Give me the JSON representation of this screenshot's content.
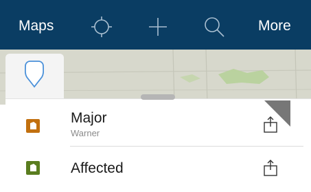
{
  "topbar": {
    "maps_label": "Maps",
    "more_label": "More",
    "icons": [
      "locate-icon",
      "plus-icon",
      "search-icon"
    ],
    "background": "#0a3d63"
  },
  "pin_tab": {
    "icon": "map-pin-icon",
    "accent": "#4a90d9"
  },
  "features": [
    {
      "title": "Major",
      "subtitle": "Warner",
      "marker_color": "#c2700f",
      "icon": "share-icon"
    },
    {
      "title": "Affected",
      "subtitle": "",
      "marker_color": "#5a7d1f",
      "icon": "share-icon"
    }
  ]
}
